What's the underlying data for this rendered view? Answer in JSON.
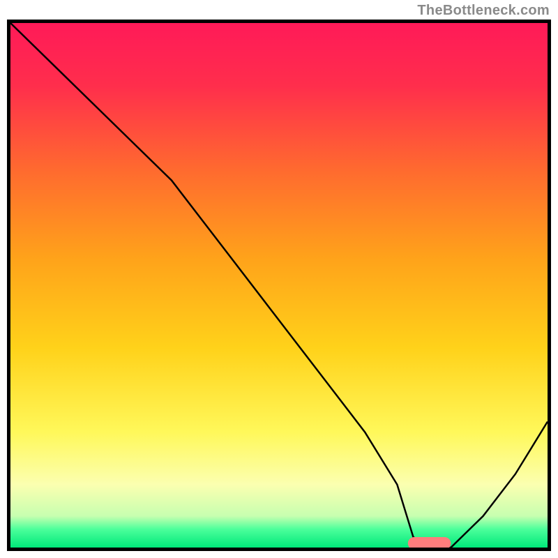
{
  "watermark": "TheBottleneck.com",
  "chart_data": {
    "type": "line",
    "title": "",
    "xlabel": "",
    "ylabel": "",
    "xlim": [
      0,
      100
    ],
    "ylim": [
      0,
      100
    ],
    "background_gradient_stops": [
      {
        "pos": 0.0,
        "color": "#ff1a58"
      },
      {
        "pos": 0.12,
        "color": "#ff2e4c"
      },
      {
        "pos": 0.28,
        "color": "#ff6a2f"
      },
      {
        "pos": 0.45,
        "color": "#ffa31a"
      },
      {
        "pos": 0.62,
        "color": "#ffd21a"
      },
      {
        "pos": 0.78,
        "color": "#fff85a"
      },
      {
        "pos": 0.88,
        "color": "#fbffb0"
      },
      {
        "pos": 0.94,
        "color": "#c7ffb0"
      },
      {
        "pos": 0.965,
        "color": "#4cff9b"
      },
      {
        "pos": 1.0,
        "color": "#00e87a"
      }
    ],
    "series": [
      {
        "name": "bottleneck-curve",
        "stroke": "#000000",
        "stroke_width": 2.5,
        "x": [
          0,
          10,
          18,
          24,
          30,
          36,
          42,
          48,
          54,
          60,
          66,
          72,
          75,
          78,
          82,
          88,
          94,
          100
        ],
        "y": [
          100,
          90,
          82,
          76,
          70,
          62,
          54,
          46,
          38,
          30,
          22,
          12,
          2,
          0,
          0,
          6,
          14,
          24
        ]
      }
    ],
    "highlight_segment": {
      "name": "optimal-range-marker",
      "color": "#ff7d7d",
      "x_start": 74,
      "x_end": 82,
      "y": 0.8,
      "thickness": 2.4
    }
  }
}
